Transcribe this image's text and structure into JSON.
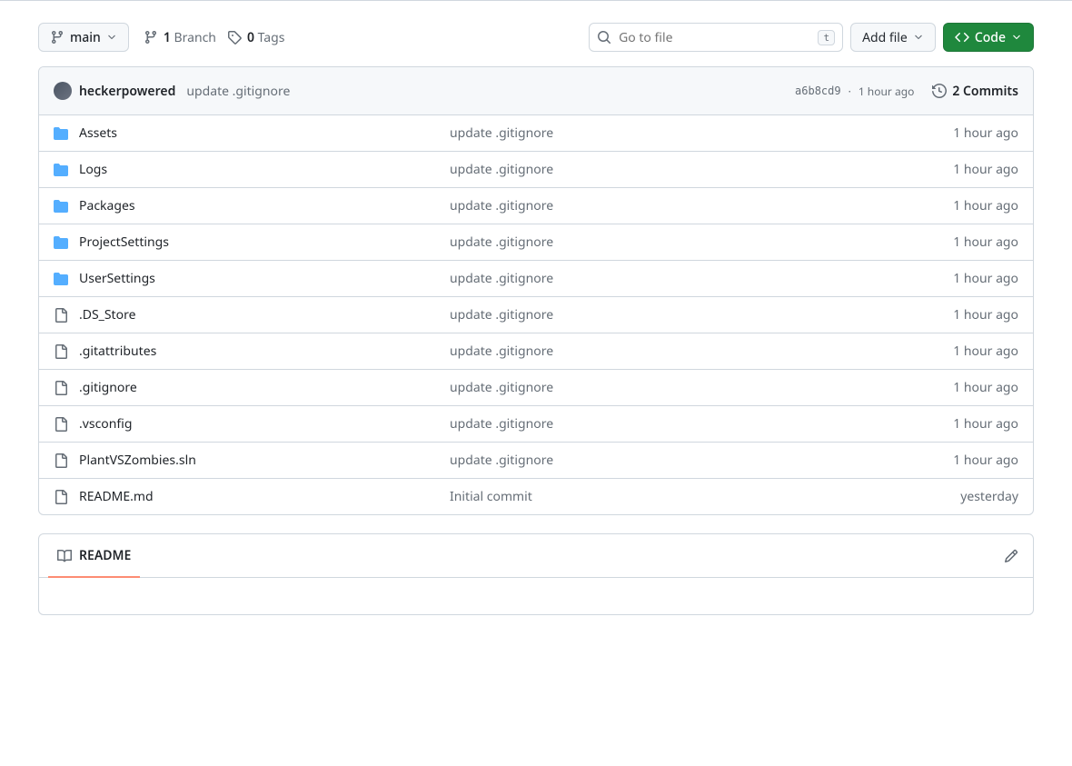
{
  "branch": {
    "label": "main"
  },
  "stats": {
    "branches_count": "1",
    "branches_label": "Branch",
    "tags_count": "0",
    "tags_label": "Tags"
  },
  "search": {
    "placeholder": "Go to file",
    "kbd": "t"
  },
  "buttons": {
    "add_file": "Add file",
    "code": "Code"
  },
  "latest_commit": {
    "author": "heckerpowered",
    "message": "update .gitignore",
    "sha": "a6b8cd9",
    "relative_time": "1 hour ago",
    "commits_count": "2",
    "commits_label": "Commits"
  },
  "files": [
    {
      "type": "folder",
      "name": "Assets",
      "message": "update .gitignore",
      "time": "1 hour ago"
    },
    {
      "type": "folder",
      "name": "Logs",
      "message": "update .gitignore",
      "time": "1 hour ago"
    },
    {
      "type": "folder",
      "name": "Packages",
      "message": "update .gitignore",
      "time": "1 hour ago"
    },
    {
      "type": "folder",
      "name": "ProjectSettings",
      "message": "update .gitignore",
      "time": "1 hour ago"
    },
    {
      "type": "folder",
      "name": "UserSettings",
      "message": "update .gitignore",
      "time": "1 hour ago"
    },
    {
      "type": "file",
      "name": ".DS_Store",
      "message": "update .gitignore",
      "time": "1 hour ago"
    },
    {
      "type": "file",
      "name": ".gitattributes",
      "message": "update .gitignore",
      "time": "1 hour ago"
    },
    {
      "type": "file",
      "name": ".gitignore",
      "message": "update .gitignore",
      "time": "1 hour ago"
    },
    {
      "type": "file",
      "name": ".vsconfig",
      "message": "update .gitignore",
      "time": "1 hour ago"
    },
    {
      "type": "file",
      "name": "PlantVSZombies.sln",
      "message": "update .gitignore",
      "time": "1 hour ago"
    },
    {
      "type": "file",
      "name": "README.md",
      "message": "Initial commit",
      "time": "yesterday"
    }
  ],
  "readme": {
    "tab_label": "README"
  }
}
